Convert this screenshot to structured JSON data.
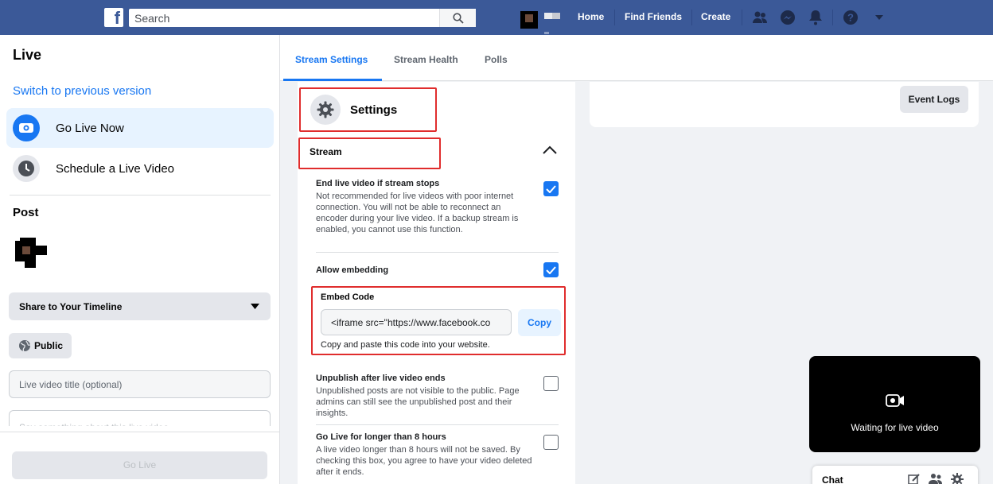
{
  "topbar": {
    "logo": "f",
    "search_placeholder": "Search",
    "nav": [
      "Home",
      "Find Friends",
      "Create"
    ],
    "icons": [
      "friends-icon",
      "messenger-icon",
      "bell-icon",
      "help-icon",
      "chevron-down-icon"
    ],
    "color": "#3b5998"
  },
  "sidebar": {
    "title": "Live",
    "switch_link": "Switch to previous version",
    "items": [
      {
        "label": "Go Live Now",
        "icon": "go-live-icon",
        "active": true
      },
      {
        "label": "Schedule a Live Video",
        "icon": "clock-icon",
        "active": false
      }
    ],
    "post_heading": "Post",
    "share_dropdown": "Share to Your Timeline",
    "privacy_button": "Public",
    "title_placeholder": "Live video title (optional)",
    "description_placeholder": "Say something about this live video",
    "go_live_button": "Go Live"
  },
  "tabs": [
    {
      "label": "Stream Settings",
      "active": true
    },
    {
      "label": "Stream Health",
      "active": false
    },
    {
      "label": "Polls",
      "active": false
    }
  ],
  "settings": {
    "title": "Settings",
    "stream_heading": "Stream",
    "options": [
      {
        "title": "End live video if stream stops",
        "desc": "Not recommended for live videos with poor internet connection. You will not be able to reconnect an encoder during your live video. If a backup stream is enabled, you cannot use this function.",
        "checked": true
      },
      {
        "title": "Allow embedding",
        "desc": "",
        "checked": true
      },
      {
        "title": "Unpublish after live video ends",
        "desc": "Unpublished posts are not visible to the public. Page admins can still see the unpublished post and their insights.",
        "checked": false
      },
      {
        "title": "Go Live for longer than 8 hours",
        "desc": "A live video longer than 8 hours will not be saved. By checking this box, you agree to have your video deleted after it ends.",
        "checked": false
      }
    ],
    "embed": {
      "label": "Embed Code",
      "value": "<iframe src=\"https://www.facebook.co",
      "copy_button": "Copy",
      "help": "Copy and paste this code into your website."
    }
  },
  "event_logs_button": "Event Logs",
  "video_preview": {
    "status": "Waiting for live video"
  },
  "chat": {
    "label": "Chat"
  },
  "accent_color": "#1877f2",
  "highlight_color": "#e02d2d"
}
